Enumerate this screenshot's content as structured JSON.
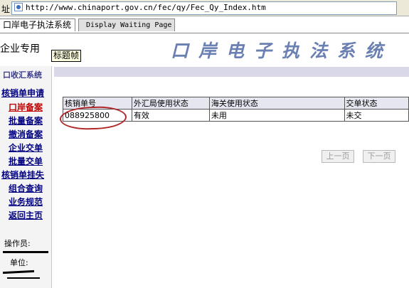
{
  "browser": {
    "address_label": "址",
    "url": "http://www.chinaport.gov.cn/fec/qy/Fec_Qy_Index.htm"
  },
  "tabs": [
    {
      "label": "口岸电子执法系统"
    },
    {
      "label": "Display Waiting Page"
    }
  ],
  "header": {
    "company_label": "企业专用",
    "frame_tooltip": "标题帧",
    "banner_title": "口岸电子执法系统"
  },
  "sidebar": {
    "title": "口收汇系统",
    "items": [
      {
        "label": "核销单申请"
      },
      {
        "label": "口岸备案"
      },
      {
        "label": "批量备案"
      },
      {
        "label": "撤消备案"
      },
      {
        "label": "企业交单"
      },
      {
        "label": "批量交单"
      },
      {
        "label": "核销单挂失"
      },
      {
        "label": "组合查询"
      },
      {
        "label": "业务规范"
      },
      {
        "label": "返回主页"
      }
    ],
    "operator_label": "操作员:",
    "unit_label": "单位:"
  },
  "table": {
    "columns": [
      "核销单号",
      "外汇局使用状态",
      "海关使用状态",
      "交单状态"
    ],
    "rows": [
      [
        "088925800",
        "有效",
        "未用",
        "未交"
      ]
    ]
  },
  "pager": {
    "prev_label": "上一页",
    "next_label": "下一页"
  },
  "colors": {
    "active_menu": "#c00000",
    "menu_link": "#000080",
    "highlight_ring": "#b0282a",
    "banner_text": "#6a7fb2"
  }
}
